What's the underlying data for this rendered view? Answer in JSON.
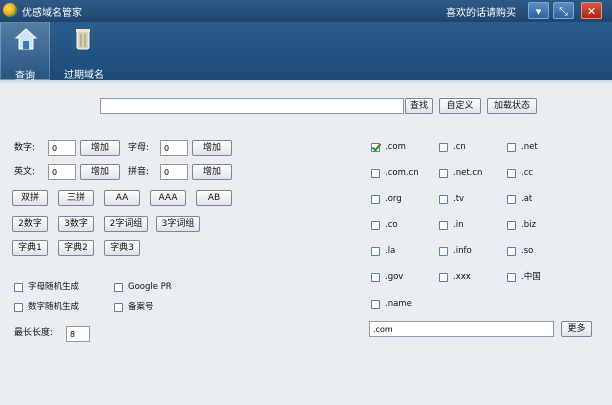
{
  "window": {
    "title": "优感域名管家",
    "like_text": "喜欢的话请购买",
    "controls": {
      "minimize": "▾",
      "restore": "⤡",
      "close": "✕"
    }
  },
  "toolbar": {
    "query_label": "查询",
    "expired_label": "过期域名"
  },
  "search": {
    "value": "",
    "find_label": "查找",
    "custom_label": "自定义",
    "load_state_label": "加载状态"
  },
  "generator": {
    "digits_label": "数字:",
    "digits_value": "0",
    "digits_add": "增加",
    "letters_label": "字母:",
    "letters_value": "0",
    "letters_add": "增加",
    "english_label": "英文:",
    "english_value": "0",
    "english_add": "增加",
    "pinyin_label": "拼音:",
    "pinyin_value": "0",
    "pinyin_add": "增加",
    "patterns": [
      "双拼",
      "三拼",
      "AA",
      "AAA",
      "AB"
    ],
    "word_groups": [
      "2数字",
      "3数字",
      "2字词组",
      "3字词组"
    ],
    "dicts": [
      "字典1",
      "字典2",
      "字典3"
    ],
    "random_letters": "字母随机生成",
    "random_digits": "数字随机生成",
    "google_pr": "Google PR",
    "beian": "备案号",
    "max_length_label": "最长长度:",
    "max_length_value": "8"
  },
  "tlds": {
    "rows": [
      [
        {
          "label": ".com",
          "checked": true
        },
        {
          "label": ".cn",
          "checked": false
        },
        {
          "label": ".net",
          "checked": false
        }
      ],
      [
        {
          "label": ".com.cn",
          "checked": false
        },
        {
          "label": ".net.cn",
          "checked": false
        },
        {
          "label": ".cc",
          "checked": false
        }
      ],
      [
        {
          "label": ".org",
          "checked": false
        },
        {
          "label": ".tv",
          "checked": false
        },
        {
          "label": ".at",
          "checked": false
        }
      ],
      [
        {
          "label": ".co",
          "checked": false
        },
        {
          "label": ".in",
          "checked": false
        },
        {
          "label": ".biz",
          "checked": false
        }
      ],
      [
        {
          "label": ".la",
          "checked": false
        },
        {
          "label": ".info",
          "checked": false
        },
        {
          "label": ".so",
          "checked": false
        }
      ],
      [
        {
          "label": ".gov",
          "checked": false
        },
        {
          "label": ".xxx",
          "checked": false
        },
        {
          "label": ".中国",
          "checked": false
        }
      ],
      [
        {
          "label": ".name",
          "checked": false
        }
      ]
    ],
    "selected_value": ".com",
    "more_label": "更多"
  }
}
